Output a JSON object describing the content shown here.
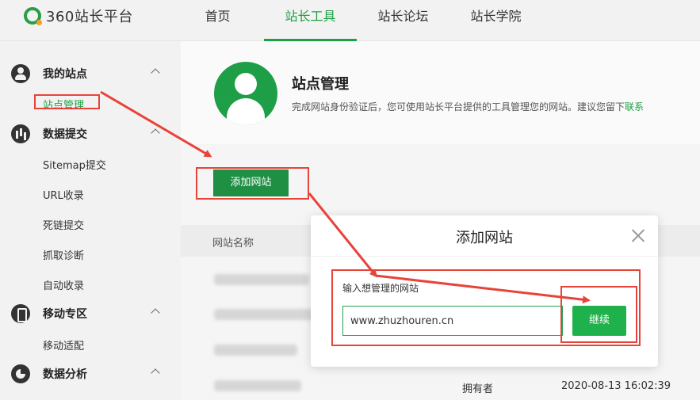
{
  "brand": {
    "logo_text": "360站长平台"
  },
  "nav": {
    "items": [
      {
        "label": "首页",
        "active": false
      },
      {
        "label": "站长工具",
        "active": true
      },
      {
        "label": "站长论坛",
        "active": false
      },
      {
        "label": "站长学院",
        "active": false
      }
    ]
  },
  "sidebar": {
    "groups": [
      {
        "label": "我的站点",
        "icon": "user-icon",
        "items": [
          "站点管理"
        ]
      },
      {
        "label": "数据提交",
        "icon": "bar-chart-icon",
        "items": [
          "Sitemap提交",
          "URL收录",
          "死链提交",
          "抓取诊断",
          "自动收录"
        ]
      },
      {
        "label": "移动专区",
        "icon": "mobile-icon",
        "items": [
          "移动适配"
        ]
      },
      {
        "label": "数据分析",
        "icon": "pie-chart-icon",
        "items": []
      }
    ]
  },
  "main": {
    "title": "站点管理",
    "description": "完成网站身份验证后，您可使用站长平台提供的工具管理您的网站。建议您留下",
    "description_link": "联系",
    "add_button": "添加网站",
    "table": {
      "column_name": "网站名称",
      "last_row": {
        "role": "拥有者",
        "time": "2020-08-13 16:02:39"
      }
    }
  },
  "modal": {
    "title": "添加网站",
    "field_label": "输入想管理的网站",
    "input_value": "www.zhuzhouren.cn",
    "continue_button": "继续"
  },
  "colors": {
    "accent": "#20a045",
    "annotation": "#e8433a"
  }
}
